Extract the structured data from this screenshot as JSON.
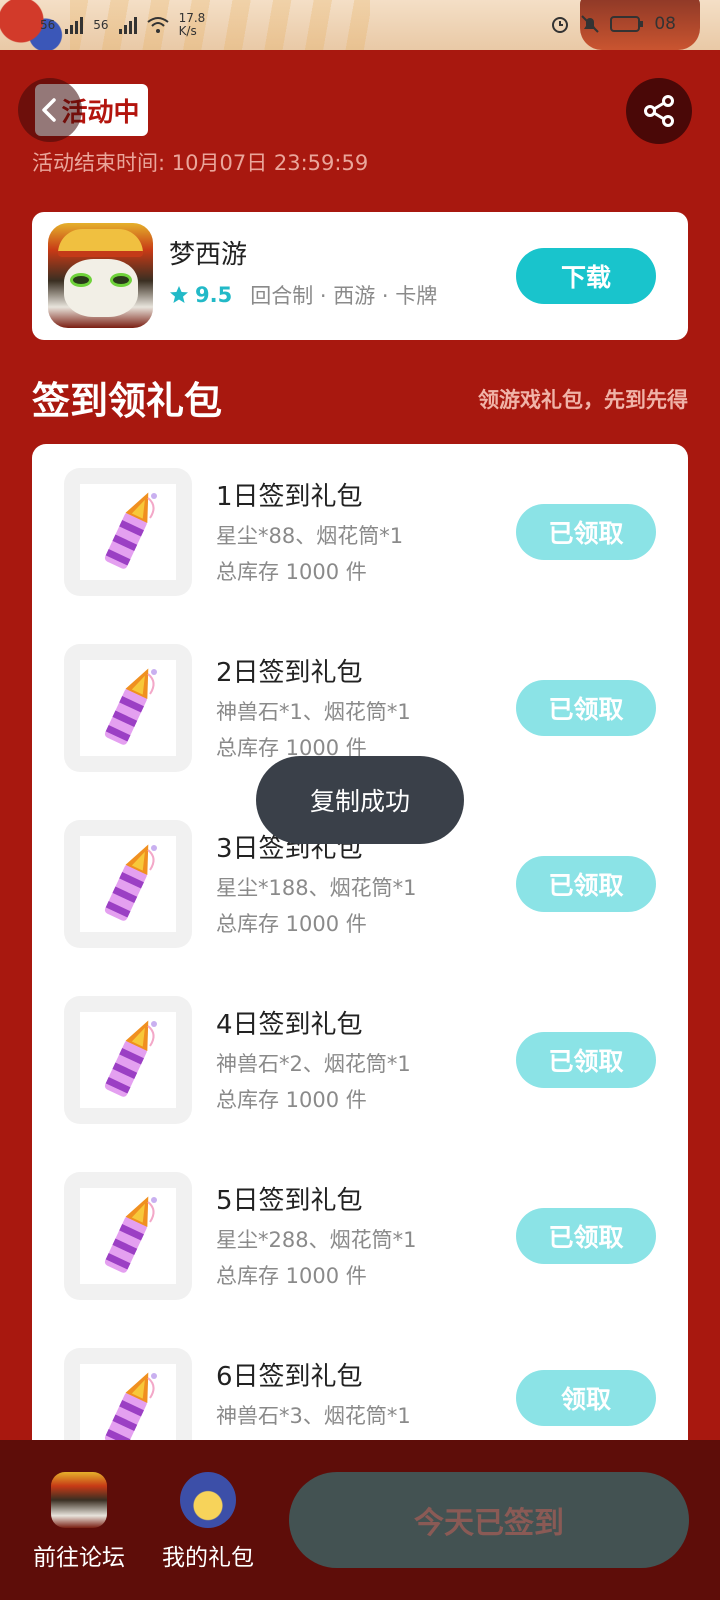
{
  "status_bar": {
    "signal_1": "56",
    "signal_2": "56",
    "speed_value": "17.8",
    "speed_unit": "K/s",
    "time": "08"
  },
  "header": {
    "badge": "活动中",
    "end_time": "活动结束时间: 10月07日 23:59:59"
  },
  "game": {
    "name": "梦西游",
    "rating": "9.5",
    "tags": "回合制 · 西游 · 卡牌",
    "download_label": "下载"
  },
  "section": {
    "title": "签到领礼包",
    "hint": "领游戏礼包，先到先得"
  },
  "gifts": [
    {
      "title": "1日签到礼包",
      "desc": "星尘*88、烟花筒*1",
      "stock": "总库存 1000 件",
      "button": "已领取"
    },
    {
      "title": "2日签到礼包",
      "desc": "神兽石*1、烟花筒*1",
      "stock": "总库存 1000 件",
      "button": "已领取"
    },
    {
      "title": "3日签到礼包",
      "desc": "星尘*188、烟花筒*1",
      "stock": "总库存 1000 件",
      "button": "已领取"
    },
    {
      "title": "4日签到礼包",
      "desc": "神兽石*2、烟花筒*1",
      "stock": "总库存 1000 件",
      "button": "已领取"
    },
    {
      "title": "5日签到礼包",
      "desc": "星尘*288、烟花筒*1",
      "stock": "总库存 1000 件",
      "button": "已领取"
    },
    {
      "title": "6日签到礼包",
      "desc": "神兽石*3、烟花筒*1",
      "stock": "",
      "button": "领取"
    }
  ],
  "toast": "复制成功",
  "bottom": {
    "forum_label": "前往论坛",
    "gifts_label": "我的礼包",
    "signed_label": "今天已签到"
  },
  "colors": {
    "background": "#a8180f",
    "accent": "#19c4cc",
    "claimed_button": "#8be3e6",
    "bottom_bar": "#5e0d09"
  }
}
